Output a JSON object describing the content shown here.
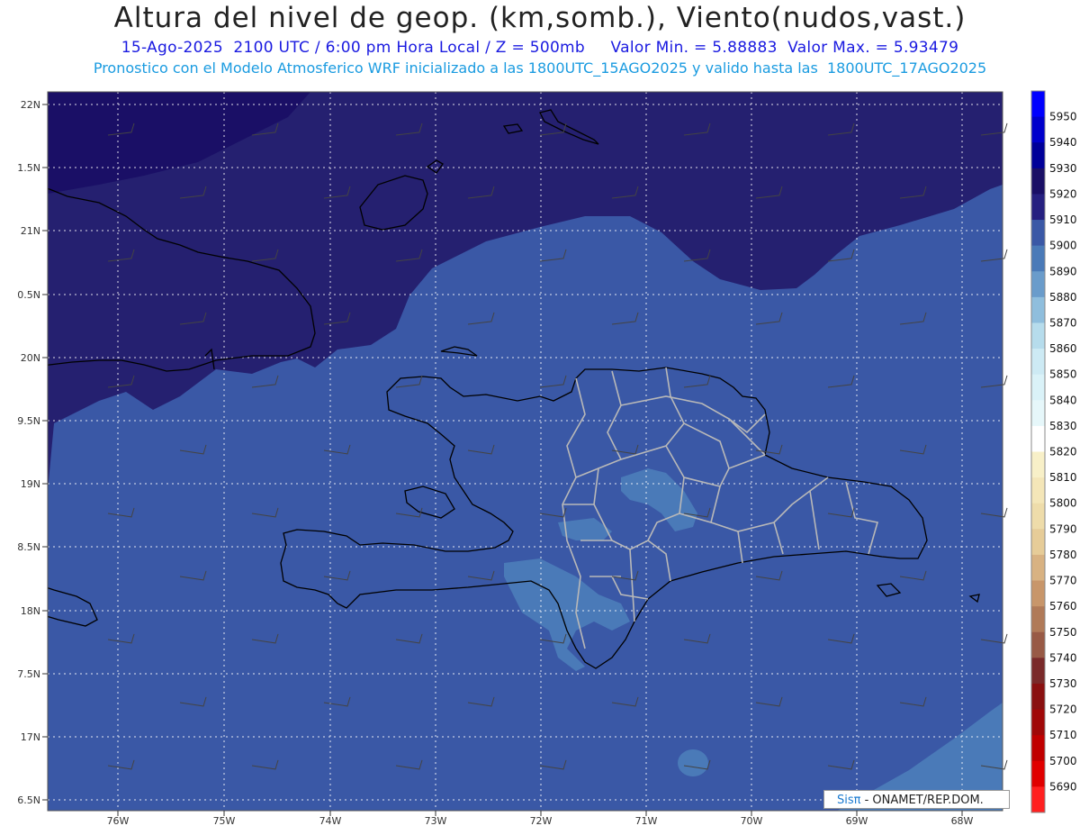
{
  "header": {
    "title": "Altura del nivel de geop. (km,somb.), Viento(nudos,vast.)",
    "line1": "15-Ago-2025  2100 UTC / 6:00 pm Hora Local / Z = 500mb     Valor Min. = 5.88883  Valor Max. = 5.93479",
    "line2": "Pronostico con el Modelo Atmosferico WRF inicializado a las 1800UTC_15AGO2025 y valido hasta las  1800UTC_17AGO2025"
  },
  "axes": {
    "lat_labels": [
      "22N",
      "1.5N",
      "21N",
      "0.5N",
      "20N",
      "9.5N",
      "19N",
      "8.5N",
      "18N",
      "7.5N",
      "17N",
      "6.5N"
    ],
    "lon_labels": [
      "76W",
      "75W",
      "74W",
      "73W",
      "72W",
      "71W",
      "70W",
      "69W",
      "68W"
    ]
  },
  "colorbar": {
    "levels": [
      5950,
      5940,
      5930,
      5920,
      5910,
      5900,
      5890,
      5880,
      5870,
      5860,
      5850,
      5840,
      5830,
      5820,
      5810,
      5800,
      5790,
      5780,
      5770,
      5760,
      5750,
      5740,
      5730,
      5720,
      5710,
      5700,
      5690
    ],
    "colors": [
      "#0000ff",
      "#0000cc",
      "#000099",
      "#1a0f66",
      "#262080",
      "#3a58a6",
      "#4a7ab8",
      "#6a9ccb",
      "#8fbedd",
      "#b6dcec",
      "#cdeaf4",
      "#daf2f8",
      "#e6f7fa",
      "#ffffff",
      "#f8f0c8",
      "#f4e6b8",
      "#eedcaa",
      "#e6cc98",
      "#d8b282",
      "#c8966a",
      "#b07a58",
      "#985a46",
      "#7a2a2a",
      "#8a1010",
      "#a00808",
      "#c00000",
      "#e00000",
      "#ff2020"
    ]
  },
  "map_colors": {
    "dark": "#252070",
    "mid": "#3a58a6",
    "light": "#4a7ab8"
  },
  "credit": {
    "brand": "Sisπ",
    "text": "- ONAMET/REP.DOM."
  }
}
